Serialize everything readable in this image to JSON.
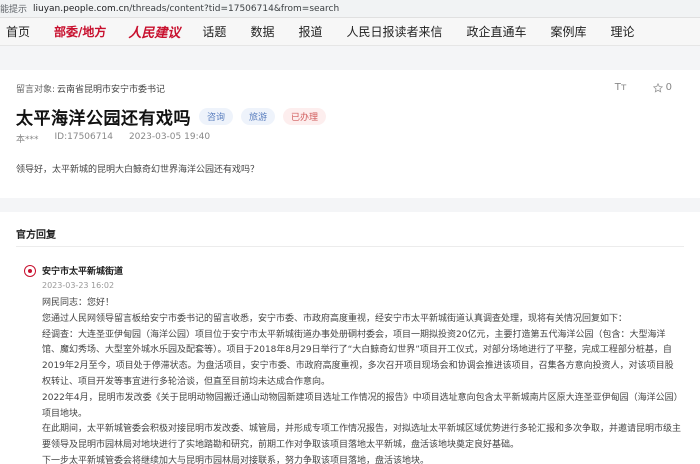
{
  "browser": {
    "tab_fragment": "能提示",
    "url_host": "liuyan.people.com.cn",
    "url_path": "/threads/content?tid=17506714&from=search"
  },
  "nav": {
    "items": [
      "首页",
      "部委/地方"
    ],
    "logo_text": "人民建议",
    "items2": [
      "话题",
      "数据",
      "报道",
      "人民日报读者来信",
      "政企直通车",
      "案例库",
      "理论"
    ],
    "active_color": "#c8102e"
  },
  "message": {
    "target_label": "留言对象:",
    "target_value": "云南省昆明市安宁市委书记",
    "font_icon": "Tт",
    "like_count": "0",
    "title": "太平海洋公园还有戏吗",
    "tags": [
      "咨询",
      "旅游"
    ],
    "status": "已办理",
    "author": "本***",
    "id": "ID:17506714",
    "time": "2023-03-05 19:40",
    "content": "领导好，太平新城的昆明大白鲸奇幻世界海洋公园还有戏吗？"
  },
  "reply": {
    "section_title": "官方回复",
    "org_name": "安宁市太平新城街道",
    "org_time": "2023-03-23 16:02",
    "paragraphs": [
      "网民同志：您好！",
      "您通过人民网领导留言板给安宁市委书记的留言收悉，安宁市委、市政府高度重视，经安宁市太平新城街道认真调查处理，现将有关情况回复如下：",
      "经调查：大连圣亚伊甸园（海洋公园）项目位于安宁市太平新城街道办事处册硐村委会，项目一期拟投资20亿元，主要打造第五代海洋公园（包含：大型海洋馆、魔幻秀场、大型室外城水乐园及配套等）。项目于2018年8月29日举行了“大白鲸奇幻世界”项目开工仪式，对部分场地进行了平整，完成工程部分桩基，自2019年2月至今，项目处于停滞状态。为盘活项目，安宁市委、市政府高度重视，多次召开项目现场会和协调会推进该项目，召集各方意向投资人，对该项目股权转让、项目开发等事宜进行多轮洽谈，但直至目前均未达成合作意向。",
      "2022年4月，昆明市发改委《关于昆明动物园搬迁通山动物园新建项目选址工作情况的报告》中项目选址意向包含太平新城南片区原大连圣亚伊甸园（海洋公园）项目地块。",
      "在此期间，太平新城管委会积极对接昆明市发改委、城管局，并形成专项工作情况报告，对拟选址太平新城区域优势进行多轮汇报和多次争取，并邀请昆明市级主要领导及昆明市园林局对地块进行了实地踏勘和研究，前期工作对争取该项目落地太平新城，盘活该地块奠定良好基础。",
      "下一步太平新城管委会将继续加大与昆明市园林局对接联系，努力争取该项目落地，盘活该地块。"
    ]
  }
}
